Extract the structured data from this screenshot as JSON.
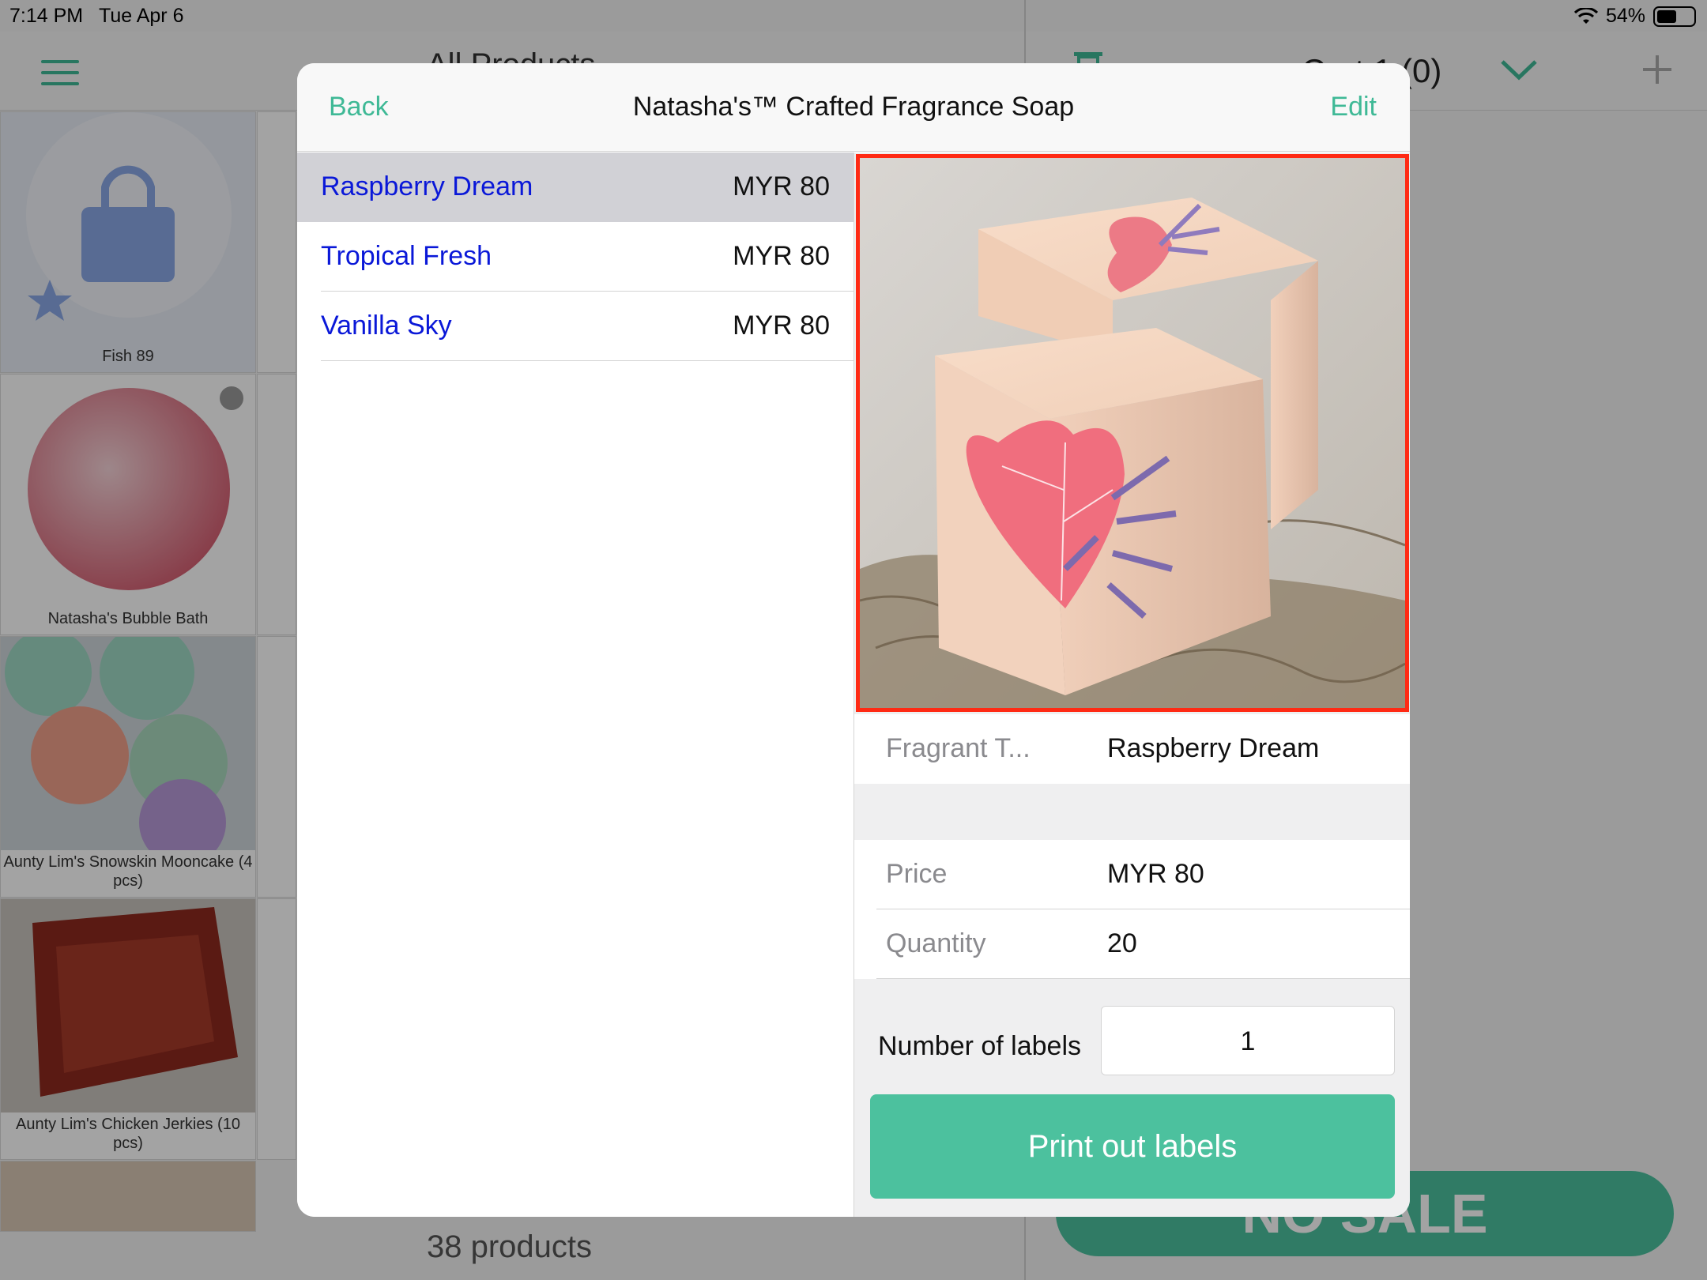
{
  "status_bar": {
    "time": "7:14 PM",
    "date": "Tue Apr 6",
    "battery": "54%",
    "battery_level": 0.54
  },
  "background": {
    "header_title": "All Products",
    "cart_title": "Cart 1 (0)",
    "product_count": "38 products",
    "no_sale_label": "NO SALE",
    "tiles": [
      {
        "label": "Fish 89"
      },
      {
        "label": "Natasha's Bubble Bath"
      },
      {
        "label": "Aunty Lim's Snowskin Mooncake (4 pcs)"
      },
      {
        "label": "Aunty Lim's Chicken Jerkies (10 pcs)"
      }
    ]
  },
  "modal": {
    "back_label": "Back",
    "title": "Natasha's™ Crafted Fragrance Soap",
    "edit_label": "Edit",
    "variants": [
      {
        "name": "Raspberry Dream",
        "price": "MYR 80"
      },
      {
        "name": "Tropical Fresh",
        "price": "MYR 80"
      },
      {
        "name": "Vanilla Sky",
        "price": "MYR 80"
      }
    ],
    "detail": {
      "option_label": "Fragrant T...",
      "option_value": "Raspberry Dream",
      "price_label": "Price",
      "price_value": "MYR 80",
      "quantity_label": "Quantity",
      "quantity_value": "20",
      "labels_count_label": "Number of labels",
      "labels_count_value": "1",
      "print_button": "Print out labels"
    }
  },
  "colors": {
    "accent": "#3fb996",
    "button": "#4cc19e",
    "link": "#0a18d8",
    "highlight_border": "#ff2a14"
  }
}
